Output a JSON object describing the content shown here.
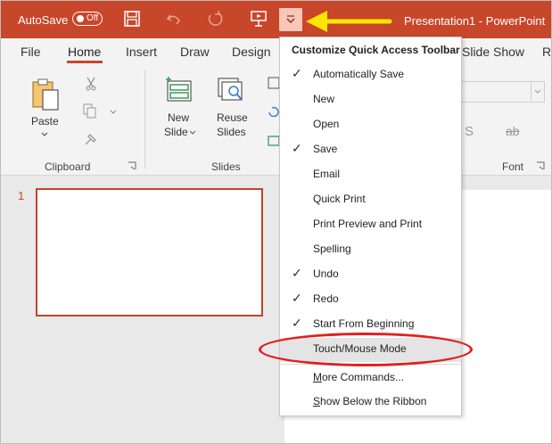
{
  "title_bar": {
    "autosave_label": "AutoSave",
    "autosave_state": "Off",
    "window_title": "Presentation1  -  PowerPoint",
    "accent_color": "#c8462a"
  },
  "tabs": [
    "File",
    "Home",
    "Insert",
    "Draw",
    "Design",
    "Slide Show",
    "R"
  ],
  "ribbon": {
    "clipboard": {
      "paste_label": "Paste",
      "group_label": "Clipboard"
    },
    "slides": {
      "new_slide_label": "New",
      "new_slide_label2": "Slide",
      "reuse_label": "Reuse",
      "reuse_label2": "Slides",
      "group_label": "Slides"
    },
    "font": {
      "group_label": "Font",
      "shadow_glyph": "S",
      "strike_glyph": "ab"
    }
  },
  "slide_panel": {
    "slide_number": "1"
  },
  "menu": {
    "header": "Customize Quick Access Toolbar",
    "items": [
      {
        "label": "Automatically Save",
        "checked": "✓"
      },
      {
        "label": "New",
        "checked": ""
      },
      {
        "label": "Open",
        "checked": ""
      },
      {
        "label": "Save",
        "checked": "✓"
      },
      {
        "label": "Email",
        "checked": ""
      },
      {
        "label": "Quick Print",
        "checked": ""
      },
      {
        "label": "Print Preview and Print",
        "checked": ""
      },
      {
        "label": "Spelling",
        "checked": ""
      },
      {
        "label": "Undo",
        "checked": "✓"
      },
      {
        "label": "Redo",
        "checked": "✓"
      },
      {
        "label": "Start From Beginning",
        "checked": "✓"
      },
      {
        "label": "Touch/Mouse Mode",
        "checked": ""
      }
    ],
    "more_commands": "More Commands...",
    "show_below": "Show Below the Ribbon"
  }
}
